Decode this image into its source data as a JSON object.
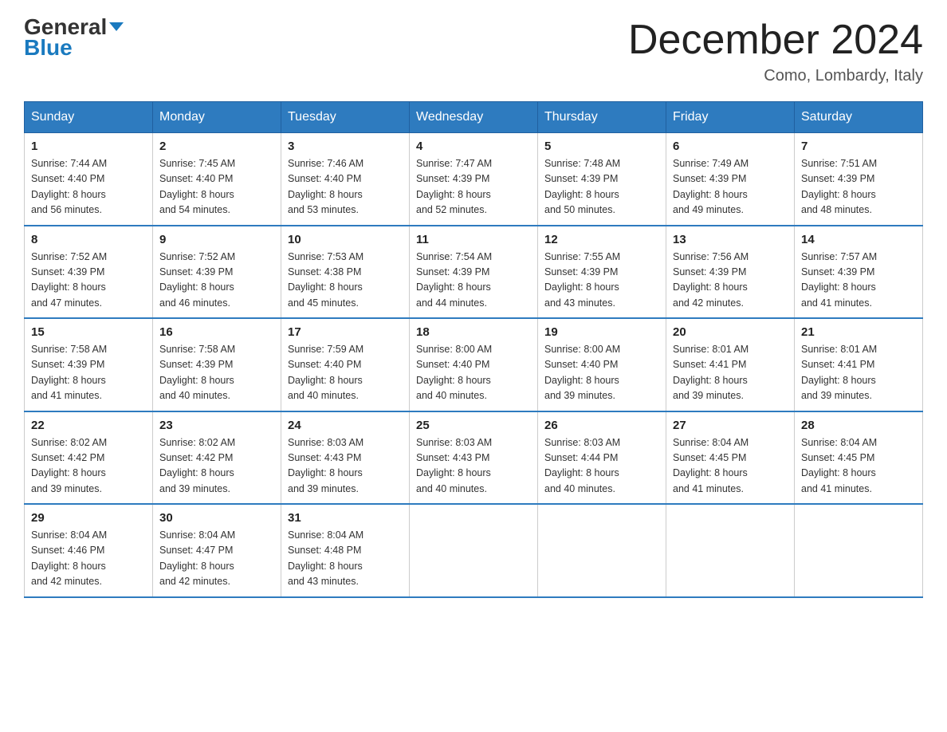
{
  "logo": {
    "part1": "General",
    "part2": "Blue"
  },
  "header": {
    "month": "December 2024",
    "location": "Como, Lombardy, Italy"
  },
  "days_of_week": [
    "Sunday",
    "Monday",
    "Tuesday",
    "Wednesday",
    "Thursday",
    "Friday",
    "Saturday"
  ],
  "weeks": [
    [
      {
        "day": "1",
        "sunrise": "7:44 AM",
        "sunset": "4:40 PM",
        "daylight": "8 hours and 56 minutes."
      },
      {
        "day": "2",
        "sunrise": "7:45 AM",
        "sunset": "4:40 PM",
        "daylight": "8 hours and 54 minutes."
      },
      {
        "day": "3",
        "sunrise": "7:46 AM",
        "sunset": "4:40 PM",
        "daylight": "8 hours and 53 minutes."
      },
      {
        "day": "4",
        "sunrise": "7:47 AM",
        "sunset": "4:39 PM",
        "daylight": "8 hours and 52 minutes."
      },
      {
        "day": "5",
        "sunrise": "7:48 AM",
        "sunset": "4:39 PM",
        "daylight": "8 hours and 50 minutes."
      },
      {
        "day": "6",
        "sunrise": "7:49 AM",
        "sunset": "4:39 PM",
        "daylight": "8 hours and 49 minutes."
      },
      {
        "day": "7",
        "sunrise": "7:51 AM",
        "sunset": "4:39 PM",
        "daylight": "8 hours and 48 minutes."
      }
    ],
    [
      {
        "day": "8",
        "sunrise": "7:52 AM",
        "sunset": "4:39 PM",
        "daylight": "8 hours and 47 minutes."
      },
      {
        "day": "9",
        "sunrise": "7:52 AM",
        "sunset": "4:39 PM",
        "daylight": "8 hours and 46 minutes."
      },
      {
        "day": "10",
        "sunrise": "7:53 AM",
        "sunset": "4:38 PM",
        "daylight": "8 hours and 45 minutes."
      },
      {
        "day": "11",
        "sunrise": "7:54 AM",
        "sunset": "4:39 PM",
        "daylight": "8 hours and 44 minutes."
      },
      {
        "day": "12",
        "sunrise": "7:55 AM",
        "sunset": "4:39 PM",
        "daylight": "8 hours and 43 minutes."
      },
      {
        "day": "13",
        "sunrise": "7:56 AM",
        "sunset": "4:39 PM",
        "daylight": "8 hours and 42 minutes."
      },
      {
        "day": "14",
        "sunrise": "7:57 AM",
        "sunset": "4:39 PM",
        "daylight": "8 hours and 41 minutes."
      }
    ],
    [
      {
        "day": "15",
        "sunrise": "7:58 AM",
        "sunset": "4:39 PM",
        "daylight": "8 hours and 41 minutes."
      },
      {
        "day": "16",
        "sunrise": "7:58 AM",
        "sunset": "4:39 PM",
        "daylight": "8 hours and 40 minutes."
      },
      {
        "day": "17",
        "sunrise": "7:59 AM",
        "sunset": "4:40 PM",
        "daylight": "8 hours and 40 minutes."
      },
      {
        "day": "18",
        "sunrise": "8:00 AM",
        "sunset": "4:40 PM",
        "daylight": "8 hours and 40 minutes."
      },
      {
        "day": "19",
        "sunrise": "8:00 AM",
        "sunset": "4:40 PM",
        "daylight": "8 hours and 39 minutes."
      },
      {
        "day": "20",
        "sunrise": "8:01 AM",
        "sunset": "4:41 PM",
        "daylight": "8 hours and 39 minutes."
      },
      {
        "day": "21",
        "sunrise": "8:01 AM",
        "sunset": "4:41 PM",
        "daylight": "8 hours and 39 minutes."
      }
    ],
    [
      {
        "day": "22",
        "sunrise": "8:02 AM",
        "sunset": "4:42 PM",
        "daylight": "8 hours and 39 minutes."
      },
      {
        "day": "23",
        "sunrise": "8:02 AM",
        "sunset": "4:42 PM",
        "daylight": "8 hours and 39 minutes."
      },
      {
        "day": "24",
        "sunrise": "8:03 AM",
        "sunset": "4:43 PM",
        "daylight": "8 hours and 39 minutes."
      },
      {
        "day": "25",
        "sunrise": "8:03 AM",
        "sunset": "4:43 PM",
        "daylight": "8 hours and 40 minutes."
      },
      {
        "day": "26",
        "sunrise": "8:03 AM",
        "sunset": "4:44 PM",
        "daylight": "8 hours and 40 minutes."
      },
      {
        "day": "27",
        "sunrise": "8:04 AM",
        "sunset": "4:45 PM",
        "daylight": "8 hours and 41 minutes."
      },
      {
        "day": "28",
        "sunrise": "8:04 AM",
        "sunset": "4:45 PM",
        "daylight": "8 hours and 41 minutes."
      }
    ],
    [
      {
        "day": "29",
        "sunrise": "8:04 AM",
        "sunset": "4:46 PM",
        "daylight": "8 hours and 42 minutes."
      },
      {
        "day": "30",
        "sunrise": "8:04 AM",
        "sunset": "4:47 PM",
        "daylight": "8 hours and 42 minutes."
      },
      {
        "day": "31",
        "sunrise": "8:04 AM",
        "sunset": "4:48 PM",
        "daylight": "8 hours and 43 minutes."
      },
      null,
      null,
      null,
      null
    ]
  ],
  "labels": {
    "sunrise": "Sunrise:",
    "sunset": "Sunset:",
    "daylight": "Daylight:"
  }
}
